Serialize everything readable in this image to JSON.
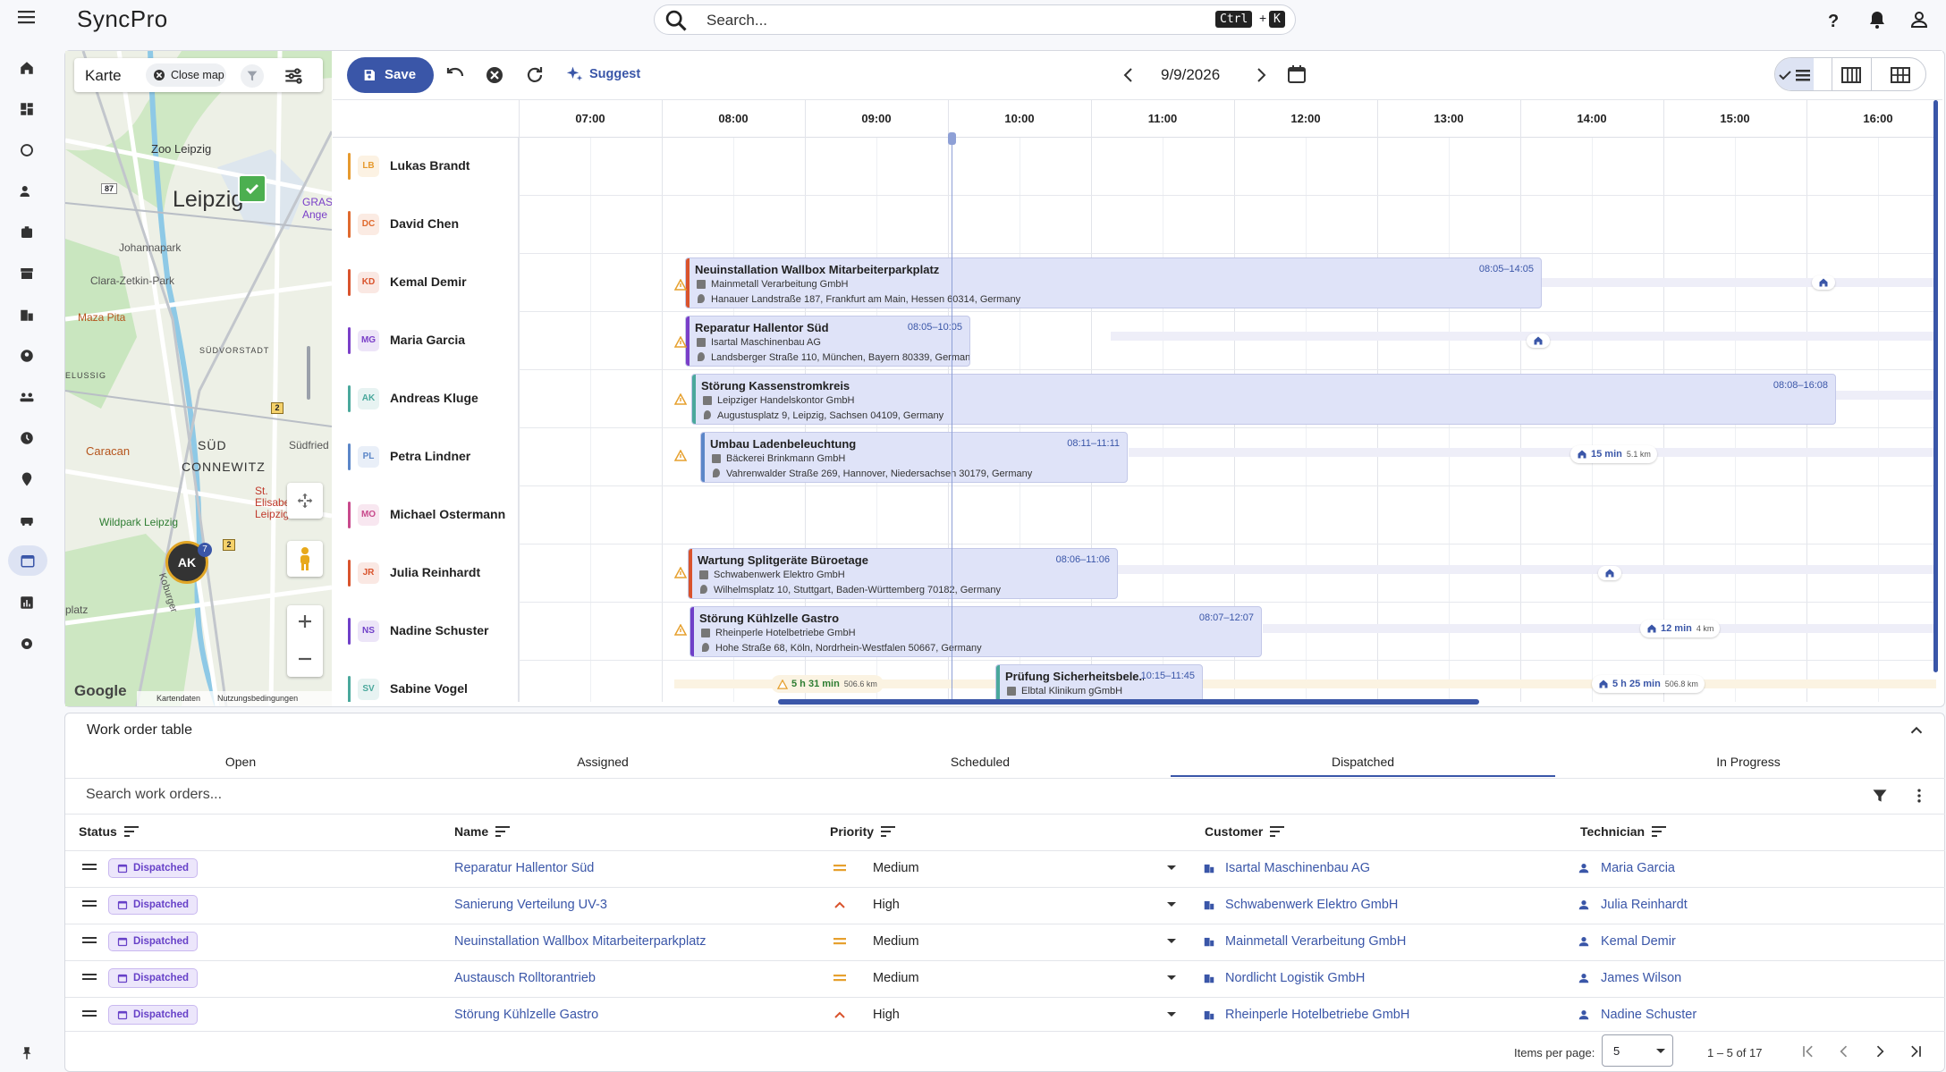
{
  "app": {
    "name": "SyncPro"
  },
  "search": {
    "placeholder": "Search...",
    "shortcut_key1": "Ctrl",
    "shortcut_plus": "+",
    "shortcut_key2": "K"
  },
  "map": {
    "title": "Karte",
    "close_label": "Close map",
    "labels": [
      "Zoo Leipzig",
      "Leipzig",
      "Johannapark",
      "Clara-Zetkin-Park",
      "Maza Pita",
      "SÜDVORSTADT",
      "ELUSSIG",
      "SÜD",
      "CONNEWITZ",
      "Caracan",
      "Südfried",
      "St. Elisabeth-Leipzig",
      "Wildpark Leipzig",
      "Koburger",
      "platz",
      "GRAS",
      "Ange"
    ],
    "marker_initials": "AK",
    "marker_count": "7",
    "attribution": [
      "Google",
      "Kartendaten",
      "Nutzungsbedingungen"
    ],
    "road_numbers": [
      "87",
      "2",
      "2"
    ]
  },
  "toolbar": {
    "save_label": "Save",
    "suggest_label": "Suggest",
    "date": "9/9/2026"
  },
  "schedule": {
    "hours": [
      "07:00",
      "08:00",
      "09:00",
      "10:00",
      "11:00",
      "12:00",
      "13:00",
      "14:00",
      "15:00",
      "16:00"
    ],
    "technicians": [
      {
        "initials": "LB",
        "name": "Lukas Brandt",
        "color": "#e69a2e"
      },
      {
        "initials": "DC",
        "name": "David Chen",
        "color": "#e06a2e"
      },
      {
        "initials": "KD",
        "name": "Kemal Demir",
        "color": "#d9532c"
      },
      {
        "initials": "MG",
        "name": "Maria Garcia",
        "color": "#7a3fc8"
      },
      {
        "initials": "AK",
        "name": "Andreas Kluge",
        "color": "#4aa89c"
      },
      {
        "initials": "PL",
        "name": "Petra Lindner",
        "color": "#5b86c8"
      },
      {
        "initials": "MO",
        "name": "Michael Ostermann",
        "color": "#c84a8c"
      },
      {
        "initials": "JR",
        "name": "Julia Reinhardt",
        "color": "#d9532c"
      },
      {
        "initials": "NS",
        "name": "Nadine Schuster",
        "color": "#6f3fc8"
      },
      {
        "initials": "SV",
        "name": "Sabine Vogel",
        "color": "#4aa89c"
      }
    ],
    "jobs": [
      {
        "title": "Neuinstallation Wallbox Mitarbeiterparkplatz",
        "time": "08:05–14:05",
        "company": "Mainmetall Verarbeitung GmbH",
        "address": "Hanauer Landstraße 187, Frankfurt am Main, Hessen 60314, Germany"
      },
      {
        "title": "Reparatur Hallentor Süd",
        "time": "08:05–10:05",
        "company": "Isartal Maschinenbau AG",
        "address": "Landsberger Straße 110, München, Bayern 80339, Germany"
      },
      {
        "title": "Störung Kassenstromkreis",
        "time": "08:08–16:08",
        "company": "Leipziger Handelskontor GmbH",
        "address": "Augustusplatz 9, Leipzig, Sachsen 04109, Germany"
      },
      {
        "title": "Umbau Ladenbeleuchtung",
        "time": "08:11–11:11",
        "company": "Bäckerei Brinkmann GmbH",
        "address": "Vahrenwalder Straße 269, Hannover, Niedersachsen 30179, Germany"
      },
      {
        "title": "Wartung Splitgeräte Büroetage",
        "time": "08:06–11:06",
        "company": "Schwabenwerk Elektro GmbH",
        "address": "Wilhelmsplatz 10, Stuttgart, Baden-Württemberg 70182, Germany"
      },
      {
        "title": "Störung Kühlzelle Gastro",
        "time": "08:07–12:07",
        "company": "Rheinperle Hotelbetriebe GmbH",
        "address": "Hohe Straße 68, Köln, Nordrhein-Westfalen 50667, Germany"
      },
      {
        "title": "Prüfung Sicherheitsbele...",
        "time": "10:15–11:45",
        "company": "Elbtal Klinikum gGmbH",
        "address": ""
      }
    ],
    "travel_pills": [
      {
        "duration": "15 min",
        "distance": "5.1 km"
      },
      {
        "duration": "12 min",
        "distance": "4 km"
      },
      {
        "duration": "5 h 25 min",
        "distance": "506.8 km"
      },
      {
        "duration": "5 h 31 min",
        "distance": "506.6 km"
      }
    ]
  },
  "work_orders": {
    "title": "Work order table",
    "tabs": [
      "Open",
      "Assigned",
      "Scheduled",
      "Dispatched",
      "In Progress"
    ],
    "active_tab": "Dispatched",
    "search_placeholder": "Search work orders...",
    "columns": [
      "Status",
      "Name",
      "Priority",
      "Customer",
      "Technician"
    ],
    "rows": [
      {
        "status": "Dispatched",
        "name": "Reparatur Hallentor Süd",
        "priority": "Medium",
        "customer": "Isartal Maschinenbau AG",
        "technician": "Maria Garcia"
      },
      {
        "status": "Dispatched",
        "name": "Sanierung Verteilung UV-3",
        "priority": "High",
        "customer": "Schwabenwerk Elektro GmbH",
        "technician": "Julia Reinhardt"
      },
      {
        "status": "Dispatched",
        "name": "Neuinstallation Wallbox Mitarbeiterparkplatz",
        "priority": "Medium",
        "customer": "Mainmetall Verarbeitung GmbH",
        "technician": "Kemal Demir"
      },
      {
        "status": "Dispatched",
        "name": "Austausch Rolltorantrieb",
        "priority": "Medium",
        "customer": "Nordlicht Logistik GmbH",
        "technician": "James Wilson"
      },
      {
        "status": "Dispatched",
        "name": "Störung Kühlzelle Gastro",
        "priority": "High",
        "customer": "Rheinperle Hotelbetriebe GmbH",
        "technician": "Nadine Schuster"
      }
    ],
    "footer": {
      "items_per_page_label": "Items per page:",
      "items_per_page": "5",
      "range": "1 – 5 of 17"
    }
  },
  "colors": {
    "accent": "#3a56a8",
    "badge": "#6741c8",
    "medium": "#e6a02e",
    "high": "#d9532c"
  }
}
